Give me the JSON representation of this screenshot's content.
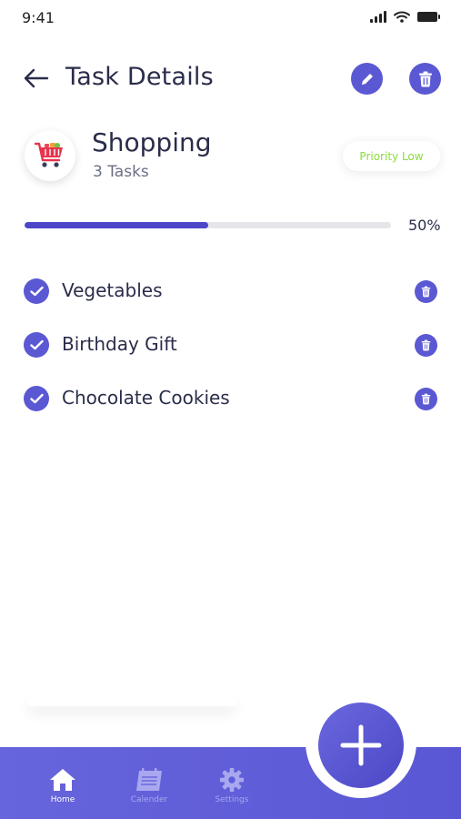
{
  "status": {
    "time": "9:41"
  },
  "header": {
    "title": "Task Details"
  },
  "category": {
    "name": "Shopping",
    "count_text": "3 Tasks",
    "priority": "Priority Low"
  },
  "progress": {
    "percent": 50,
    "label": "50%"
  },
  "tasks": [
    {
      "label": "Vegetables",
      "done": true
    },
    {
      "label": "Birthday Gift",
      "done": true
    },
    {
      "label": "Chocolate Cookies",
      "done": true
    }
  ],
  "nav": {
    "home": "Home",
    "calendar": "Calender",
    "settings": "Settings"
  },
  "colors": {
    "accent": "#5b58d3",
    "priority_low": "#8bdc3c"
  },
  "icons": [
    "back-arrow-icon",
    "edit-pencil-icon",
    "trash-icon",
    "shopping-cart-icon",
    "check-icon",
    "home-icon",
    "calendar-icon",
    "gear-icon",
    "plus-icon"
  ]
}
